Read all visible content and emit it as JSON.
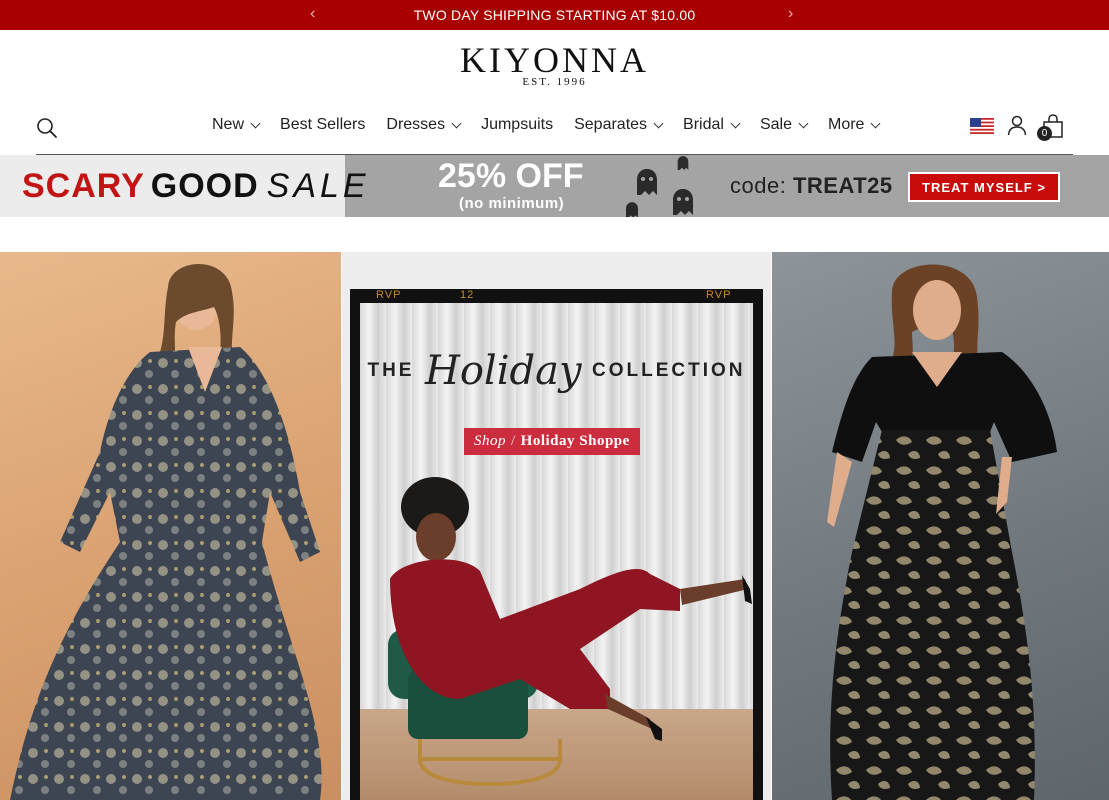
{
  "announcement": {
    "text": "TWO DAY SHIPPING STARTING AT $10.00",
    "prev_icon": "chevron-left",
    "next_icon": "chevron-right"
  },
  "logo": {
    "brand": "KIYONNA",
    "tagline": "EST. 1996"
  },
  "header": {
    "nav": [
      {
        "label": "New",
        "dropdown": true
      },
      {
        "label": "Best Sellers",
        "dropdown": false
      },
      {
        "label": "Dresses",
        "dropdown": true
      },
      {
        "label": "Jumpsuits",
        "dropdown": false
      },
      {
        "label": "Separates",
        "dropdown": true
      },
      {
        "label": "Bridal",
        "dropdown": true
      },
      {
        "label": "Sale",
        "dropdown": true
      },
      {
        "label": "More",
        "dropdown": true
      }
    ],
    "cart_count": "0",
    "icons": [
      "search-icon",
      "us-flag-icon",
      "account-icon",
      "cart-icon"
    ]
  },
  "promo": {
    "scary": "SCARY",
    "good": "GOOD",
    "sale": "SALE",
    "discount": "25% OFF",
    "discount_note": "(no minimum)",
    "code_label": "code:",
    "code": "TREAT25",
    "cta": "TREAT MYSELF >"
  },
  "hero": {
    "center": {
      "film_left": "RVP",
      "film_mid": "12",
      "film_right": "RVP",
      "title_the": "THE",
      "title_script": "Holiday",
      "title_collection": "COLLECTION",
      "shop": "Shop",
      "slash": "/",
      "shop_link": "Holiday Shoppe"
    }
  },
  "colors": {
    "announcement_bg": "#a80000",
    "promo_red": "#c80c0c",
    "badge_red": "#cc2d3e"
  }
}
